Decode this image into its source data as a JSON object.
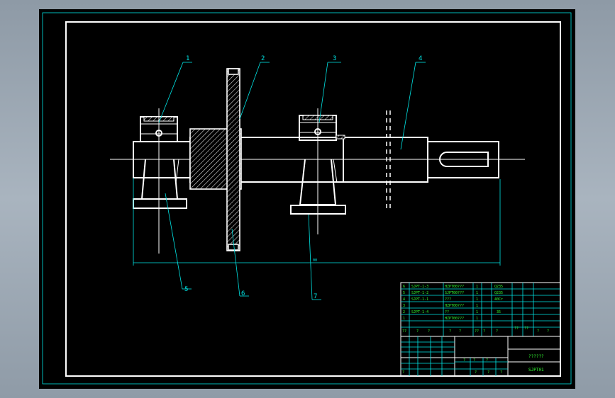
{
  "drawing": {
    "part_callouts": [
      "1",
      "2",
      "3",
      "4",
      "5",
      "6",
      "7"
    ],
    "overall_dimension": "00",
    "bom_rows": [
      {
        "no": "6",
        "code": "SJPT-1-3",
        "name": "HZPT00???",
        "qty": "1",
        "material": "Q235",
        "note": ""
      },
      {
        "no": "5",
        "code": "SJPT-1-2",
        "name": "SJPT00???",
        "qty": "1",
        "material": "Q235",
        "note": ""
      },
      {
        "no": "4",
        "code": "SJPT-1-1",
        "name": "???",
        "qty": "1",
        "material": "40Cr",
        "note": ""
      },
      {
        "no": "3",
        "code": "",
        "name": "HZPT00???",
        "qty": "1",
        "material": "",
        "note": ""
      },
      {
        "no": "2",
        "code": "SJPT-1-4",
        "name": "??",
        "qty": "1",
        "material": "35",
        "note": ""
      },
      {
        "no": "1",
        "code": "",
        "name": "HZPT00???",
        "qty": "1",
        "material": "",
        "note": ""
      }
    ],
    "bom_header": [
      "??",
      "?",
      "?",
      "?",
      "?",
      "??",
      "?",
      "?",
      "??",
      "??",
      "?",
      "?"
    ],
    "title_block": {
      "drawing_name": "??????",
      "drawing_number": "SJPT01",
      "scale_marks": [
        "?",
        "?",
        "?",
        "?",
        "?"
      ],
      "sheet_marks": [
        "?",
        "?"
      ]
    }
  }
}
